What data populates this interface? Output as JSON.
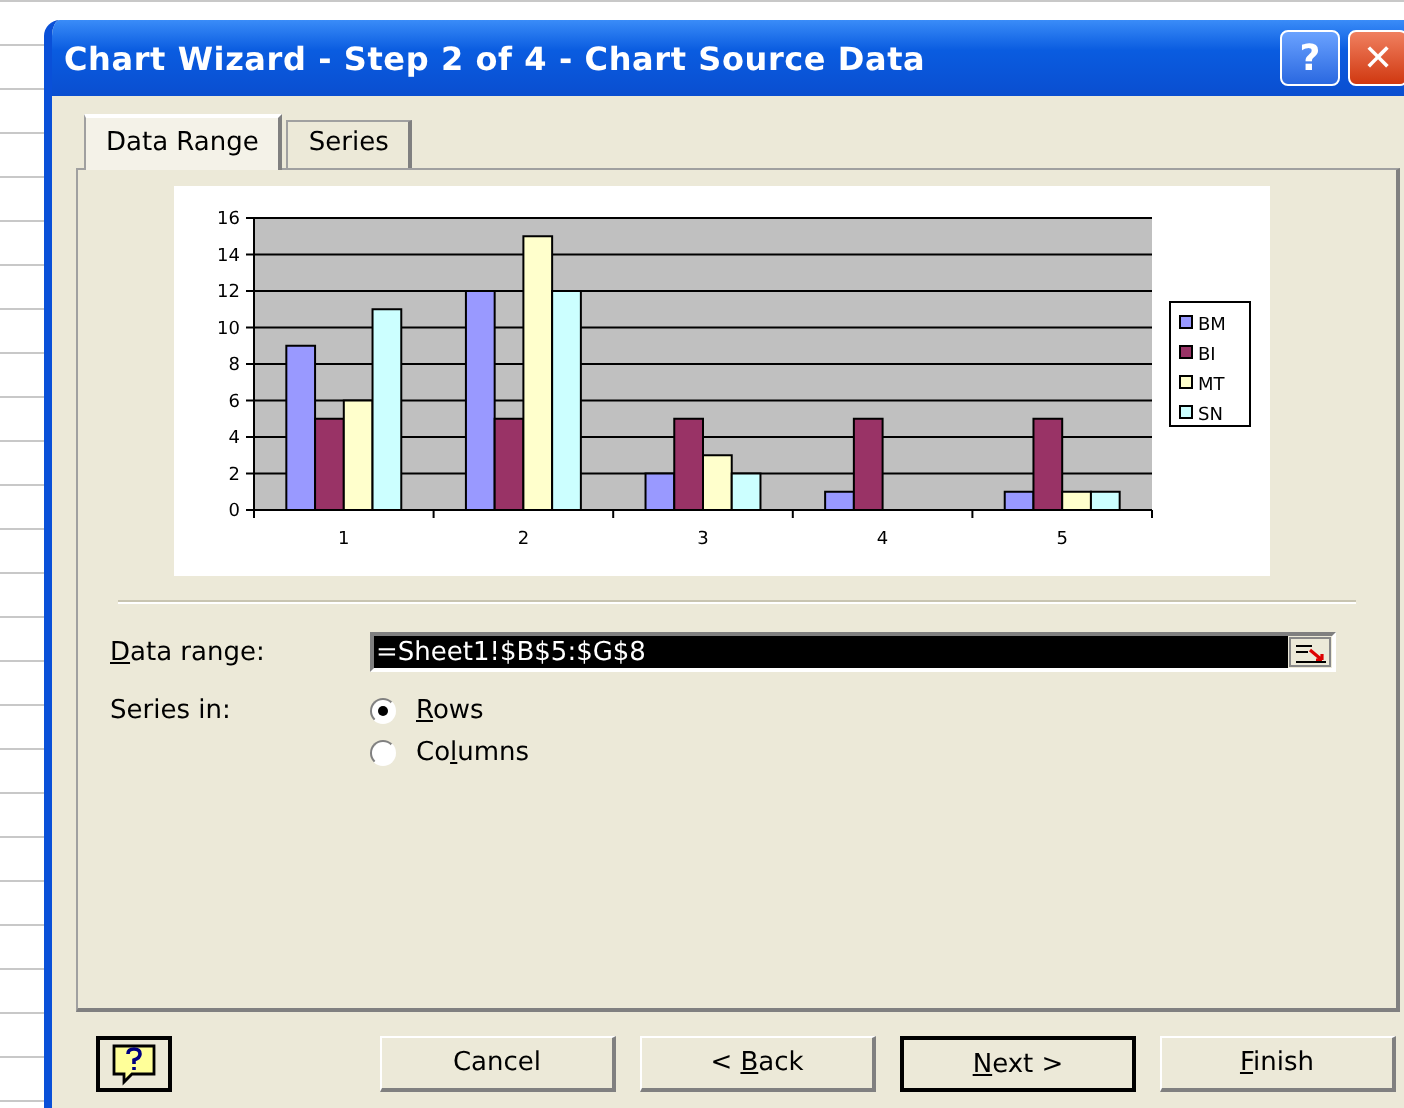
{
  "window": {
    "title": "Chart Wizard - Step 2 of 4 - Chart Source Data",
    "help_button": "?",
    "close_button": "✕"
  },
  "tabs": [
    {
      "label": "Data Range",
      "selected": true
    },
    {
      "label": "Series",
      "selected": false
    }
  ],
  "chart_data": {
    "type": "bar",
    "categories": [
      "1",
      "2",
      "3",
      "4",
      "5"
    ],
    "series": [
      {
        "name": "BM",
        "color": "#9999ff",
        "values": [
          9,
          12,
          2,
          1,
          1
        ]
      },
      {
        "name": "BI",
        "color": "#993366",
        "values": [
          5,
          5,
          5,
          5,
          5
        ]
      },
      {
        "name": "MT",
        "color": "#ffffcc",
        "values": [
          6,
          15,
          3,
          0,
          1
        ]
      },
      {
        "name": "SN",
        "color": "#ccffff",
        "values": [
          11,
          12,
          2,
          0,
          1
        ]
      }
    ],
    "ylim": [
      0,
      16
    ],
    "yticks": [
      0,
      2,
      4,
      6,
      8,
      10,
      12,
      14,
      16
    ],
    "grid": true,
    "legend": true
  },
  "data_range": {
    "label": [
      {
        "text": "D",
        "underline": true
      },
      {
        "text": "ata range:",
        "underline": false
      }
    ],
    "value": "=Sheet1!$B$5:$G$8"
  },
  "series_in": {
    "label": "Series in:",
    "options": [
      {
        "label": [
          {
            "text": "R",
            "underline": true
          },
          {
            "text": "ows",
            "underline": false
          }
        ],
        "selected": true
      },
      {
        "label": [
          {
            "text": "Co",
            "underline": false
          },
          {
            "text": "l",
            "underline": true
          },
          {
            "text": "umns",
            "underline": false
          }
        ],
        "selected": false
      }
    ]
  },
  "buttons": [
    {
      "label": [
        {
          "text": "Cancel",
          "underline": false
        }
      ],
      "default": false
    },
    {
      "label": [
        {
          "text": "< ",
          "underline": false
        },
        {
          "text": "B",
          "underline": true
        },
        {
          "text": "ack",
          "underline": false
        }
      ],
      "default": false
    },
    {
      "label": [
        {
          "text": "N",
          "underline": true
        },
        {
          "text": "ext >",
          "underline": false
        }
      ],
      "default": true
    },
    {
      "label": [
        {
          "text": "F",
          "underline": true
        },
        {
          "text": "inish",
          "underline": false
        }
      ],
      "default": false
    }
  ]
}
